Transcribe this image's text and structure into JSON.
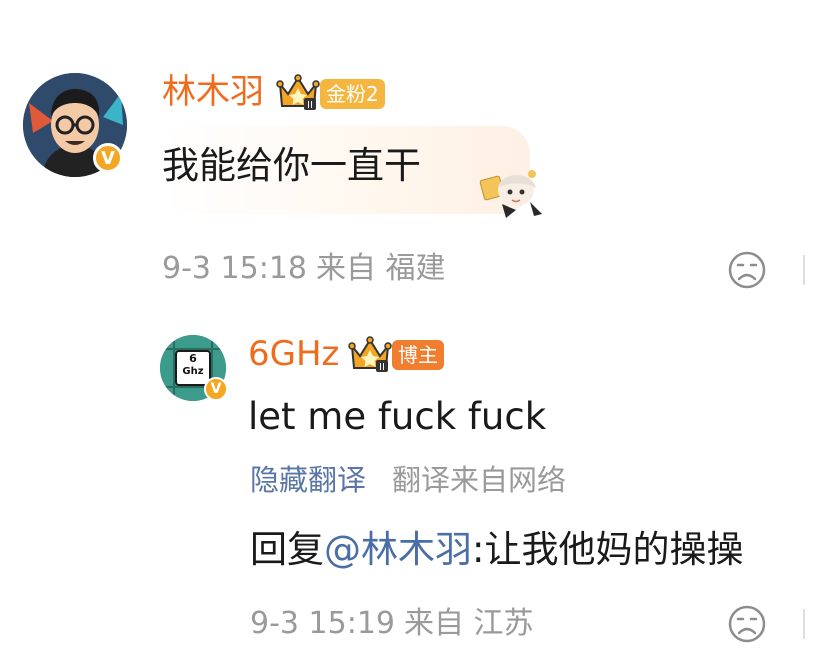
{
  "comment": {
    "username": "林木羽",
    "fan_badge": "金粉2",
    "text": "我能给你一直干",
    "time": "9-3 15:18",
    "location": "来自 福建",
    "icons": {
      "avatar": "man-with-glasses-avatar",
      "verified": "v-verified-icon",
      "crown": "crown-icon",
      "sticker": "anime-character-sticker",
      "reaction": "sad-face-icon"
    },
    "verified_label": "V"
  },
  "reply": {
    "username": "6GHz",
    "role_badge": "博主",
    "avatar_text_top": "6",
    "avatar_text_bottom": "Ghz",
    "verified_label": "V",
    "text": "let me fuck fuck",
    "translate_toggle": "隐藏翻译",
    "translate_source": "翻译来自网络",
    "reply_prefix": "回复",
    "mention": "@林木羽",
    "reply_text": ":让我他妈的操操",
    "time": "9-3 15:19",
    "location": "来自 江苏",
    "icons": {
      "avatar": "cpu-chip-avatar",
      "verified": "v-verified-icon",
      "crown": "crown-icon",
      "reaction": "sad-face-icon"
    }
  },
  "colors": {
    "username": "#f06c1d",
    "fan_badge": "#f5b640",
    "blogger_badge": "#f17d2e",
    "link": "#4a6ea8",
    "meta": "#9a9a9a"
  }
}
